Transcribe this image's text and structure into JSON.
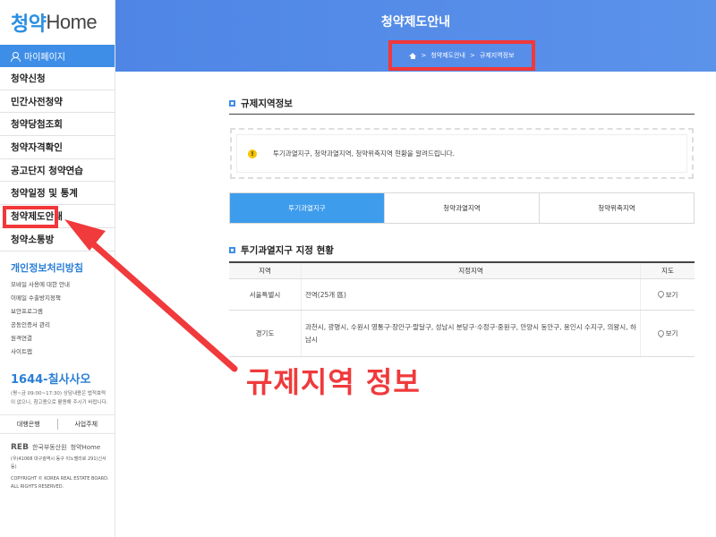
{
  "sidebar": {
    "logo_ko": "청약",
    "logo_en": "Home",
    "mypage": "마이페이지",
    "menu": [
      "청약신청",
      "민간사전청약",
      "청약당첨조회",
      "청약자격확인",
      "공고단지 청약연습",
      "청약일정 및 통계",
      "청약제도안내",
      "청약소통방"
    ],
    "privacy_title": "개인정보처리방침",
    "sub_links": [
      "모바일 사용에 대한 안내",
      "이메일 수출방지정책",
      "보안프로그램",
      "공동인증서 관리",
      "원격연결",
      "사이트맵"
    ],
    "phone": "1644-칠사사오",
    "phone_note": "(평~금 09:00~17:30) 상담내용은 법적효력이 없으니, 참고용으로 활용해 주시기 바랍니다.",
    "foot_links": [
      "대행은행",
      "사업주체"
    ],
    "org_logo": "REB",
    "org_name": "한국부동산원",
    "org_brand": "청약Home",
    "address": "(우)41068 대구광역시 동구 이노밸리로 291(신서동)",
    "copyright": "COPYRIGHT © KOREA REAL ESTATE BOARD. ALL RIGHTS RESERVED."
  },
  "header": {
    "title": "청약제도안내",
    "breadcrumb": [
      "청약제도안내",
      "규제지역정보"
    ]
  },
  "main": {
    "section1_title": "규제지역정보",
    "notice": "투기과열지구, 청약과열지역, 청약위축지역 현황을 알려드립니다.",
    "tabs": [
      "투기과열지구",
      "청약과열지역",
      "청약위축지역"
    ],
    "section2_title": "투기과열지구 지정 현황",
    "table": {
      "headers": [
        "지역",
        "지정지역",
        "지도"
      ],
      "rows": [
        {
          "region": "서울특별시",
          "areas": "전역(25개 區)",
          "map": "보기"
        },
        {
          "region": "경기도",
          "areas": "과천시, 광명시, 수원시 영통구·장안구·팔달구, 성남시 분당구·수정구·중원구, 안양시 동안구, 용인시 수지구, 의왕시, 하남시",
          "map": "보기"
        }
      ]
    }
  },
  "annotation": {
    "text": "규제지역 정보",
    "color": "#f03a3c"
  },
  "colors": {
    "accent": "#3e8ee8",
    "highlight": "#f2383a"
  }
}
